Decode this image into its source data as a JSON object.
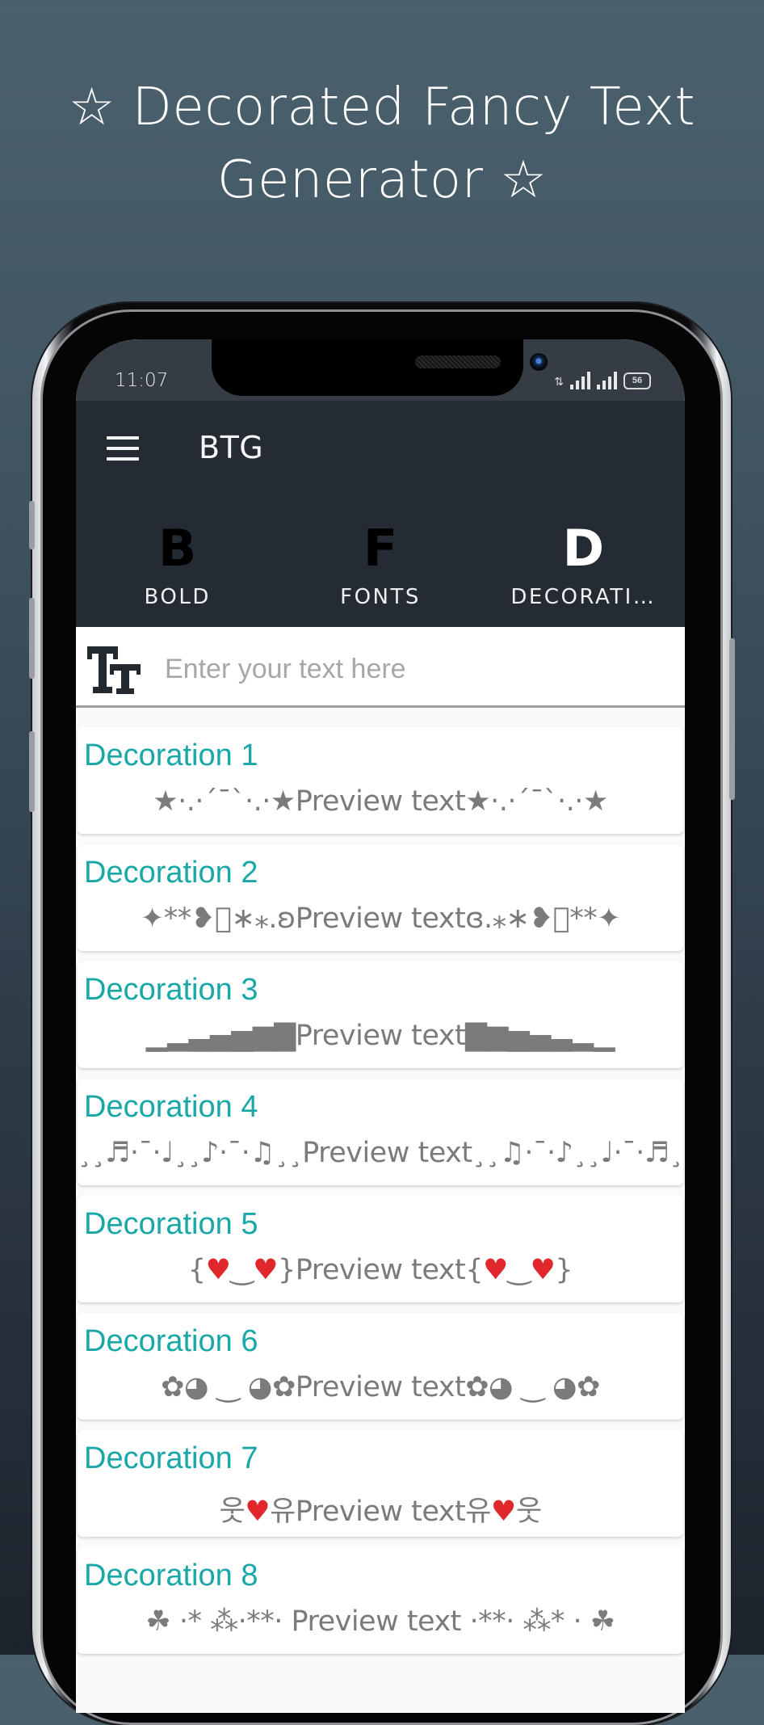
{
  "promo": {
    "title_line1": "☆ Decorated Fancy Text",
    "title_line2": "Generator ☆"
  },
  "status_bar": {
    "time": "11:07",
    "battery": "56"
  },
  "app_bar": {
    "menu_icon": "hamburger-menu-icon",
    "title": "BTG"
  },
  "tabs": [
    {
      "icon_letter": "B",
      "label": "BOLD",
      "active": false
    },
    {
      "icon_letter": "F",
      "label": "FONTS",
      "active": false
    },
    {
      "icon_letter": "D",
      "label": "DECORATI…",
      "active": true
    }
  ],
  "search": {
    "icon": "text-size-icon",
    "placeholder": "Enter your text here",
    "value": ""
  },
  "colors": {
    "accent": "#1aa7a8",
    "app_bar": "#242b33",
    "status_bar": "#363c44",
    "preview_text": "#7b7b7b",
    "heart": "#e0282c"
  },
  "decorations": [
    {
      "title": "Decoration 1",
      "preview": "★·.·´¯`·.·★Preview text★·.·´¯`·.·★"
    },
    {
      "title": "Decoration 2",
      "preview": "✦**❥⃝∗⁎.ʚPreview textɞ.⁎∗❥⃝**✦"
    },
    {
      "title": "Decoration 3",
      "preview": "▁▂▃▄▅▆▇Preview text▇▆▅▄▃▂▁"
    },
    {
      "title": "Decoration 4",
      "preview": "¸¸♬·¯·♩¸¸♪·¯·♫¸¸Preview text¸¸♫·¯·♪¸¸♩·¯·♬¸¸"
    },
    {
      "title": "Decoration 5",
      "preview_parts": [
        "{",
        "♥",
        "‿",
        "♥",
        "}Preview text{",
        "♥",
        "‿",
        "♥",
        "}"
      ]
    },
    {
      "title": "Decoration 6",
      "preview": "✿◕ ‿ ◕✿Preview text✿◕ ‿ ◕✿"
    },
    {
      "title": "Decoration 7",
      "preview_parts": [
        "웃",
        "♥",
        "유Preview text유",
        "♥",
        "웃"
      ]
    },
    {
      "title": "Decoration 8",
      "preview": "☘   ·* ⁂·**· Preview text ·**· ⁂* ·   ☘"
    }
  ]
}
